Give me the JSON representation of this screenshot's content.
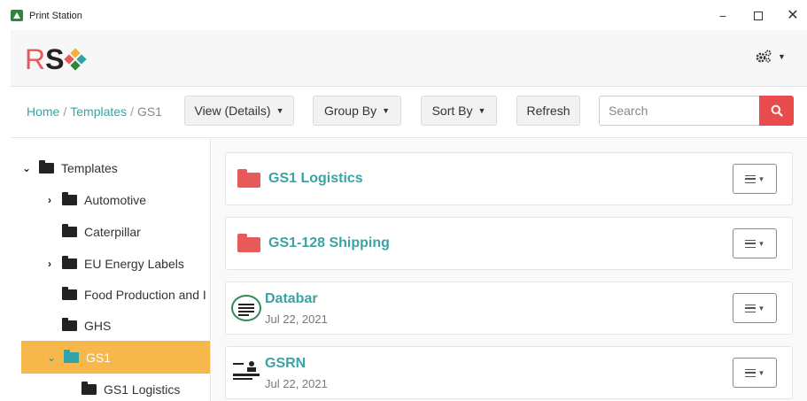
{
  "window": {
    "title": "Print Station",
    "minimize_label": "−",
    "close_label": "✕"
  },
  "header": {
    "logo_r": "R",
    "logo_s": "S",
    "logo_colors": [
      "#f2b134",
      "#e55a5a",
      "#2fa4a8",
      "#2e8540"
    ],
    "settings_icon": "gear-icon"
  },
  "toolbar": {
    "breadcrumb": [
      "Home",
      "Templates",
      "GS1"
    ],
    "breadcrumb_separator": "/",
    "view_label": "View (Details)",
    "group_label": "Group By",
    "sort_label": "Sort By",
    "refresh_label": "Refresh",
    "search_placeholder": "Search"
  },
  "sidebar": {
    "items": [
      {
        "label": "Templates",
        "expander": "expanded"
      },
      {
        "label": "Automotive",
        "expander": "collapsed"
      },
      {
        "label": "Caterpillar",
        "expander": "none"
      },
      {
        "label": "EU Energy Labels",
        "expander": "collapsed"
      },
      {
        "label": "Food Production and I",
        "expander": "none"
      },
      {
        "label": "GHS",
        "expander": "none"
      },
      {
        "label": "GS1",
        "expander": "expanded",
        "selected": true
      },
      {
        "label": "GS1 Logistics",
        "expander": "none"
      }
    ]
  },
  "main": {
    "cards": [
      {
        "type": "folder",
        "title": "GS1 Logistics"
      },
      {
        "type": "folder",
        "title": "GS1-128 Shipping"
      },
      {
        "type": "template",
        "title": "Databar",
        "date": "Jul 22, 2021"
      },
      {
        "type": "template",
        "title": "GSRN",
        "date": "Jul 22, 2021"
      }
    ]
  },
  "colors": {
    "accent_teal": "#3aa3a3",
    "selected_bg": "#f7b84b",
    "search_button": "#e84c4c",
    "folder_red": "#e75a5a"
  }
}
